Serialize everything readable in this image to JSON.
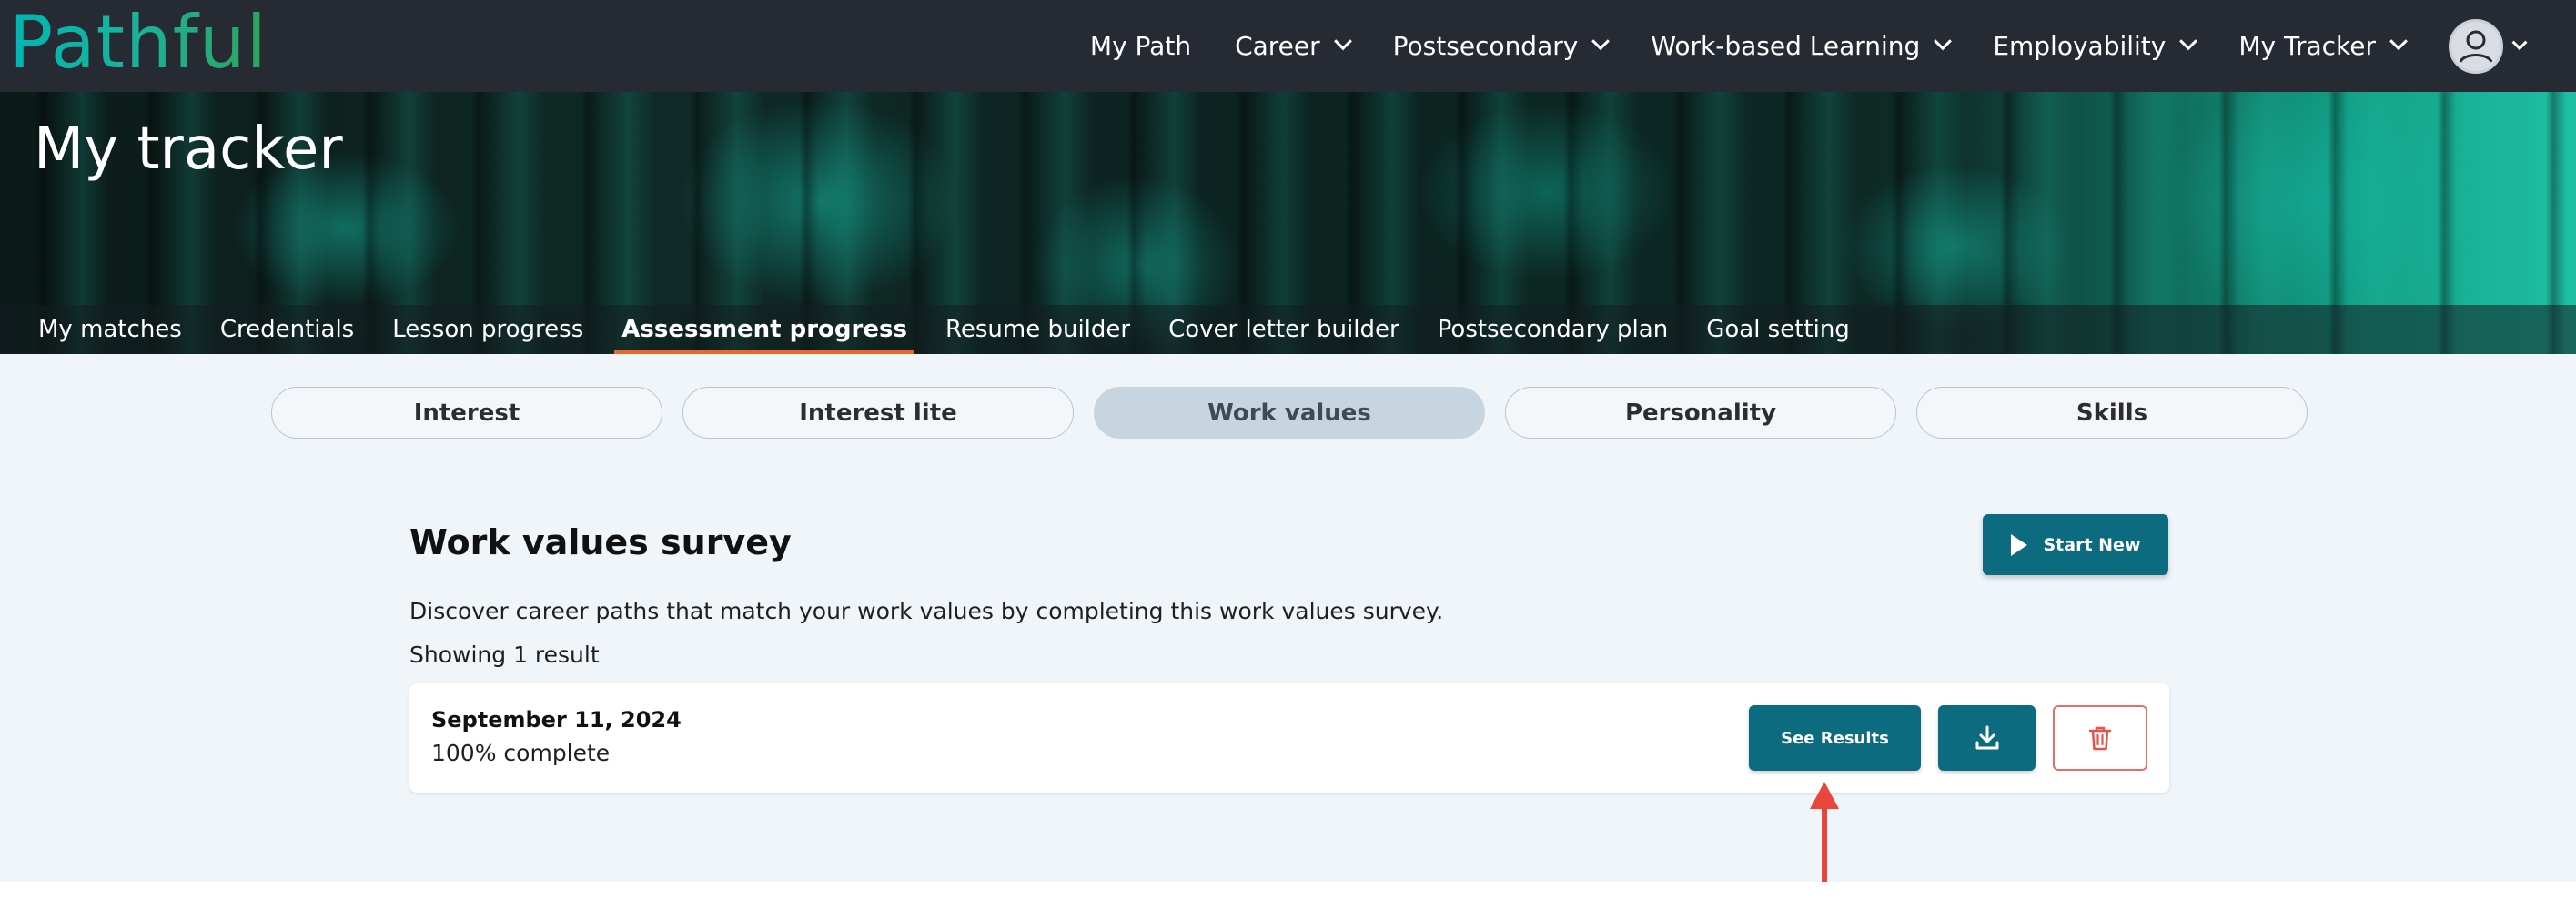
{
  "brand": {
    "logo_text": "Pathful"
  },
  "topnav": {
    "items": [
      {
        "label": "My Path",
        "has_dropdown": false
      },
      {
        "label": "Career",
        "has_dropdown": true
      },
      {
        "label": "Postsecondary",
        "has_dropdown": true
      },
      {
        "label": "Work-based Learning",
        "has_dropdown": true
      },
      {
        "label": "Employability",
        "has_dropdown": true
      },
      {
        "label": "My Tracker",
        "has_dropdown": true
      }
    ],
    "avatar_icon": "user-circle-icon"
  },
  "hero": {
    "title": "My tracker",
    "tabs": [
      {
        "label": "My matches",
        "active": false
      },
      {
        "label": "Credentials",
        "active": false
      },
      {
        "label": "Lesson progress",
        "active": false
      },
      {
        "label": "Assessment progress",
        "active": true
      },
      {
        "label": "Resume builder",
        "active": false
      },
      {
        "label": "Cover letter builder",
        "active": false
      },
      {
        "label": "Postsecondary plan",
        "active": false
      },
      {
        "label": "Goal setting",
        "active": false
      }
    ]
  },
  "assessment_tabs": [
    {
      "label": "Interest",
      "active": false
    },
    {
      "label": "Interest lite",
      "active": false
    },
    {
      "label": "Work values",
      "active": true
    },
    {
      "label": "Personality",
      "active": false
    },
    {
      "label": "Skills",
      "active": false
    }
  ],
  "survey": {
    "title": "Work values survey",
    "start_button": "Start New",
    "description": "Discover career paths that match your work values by completing this work values survey.",
    "result_count": "Showing 1 result"
  },
  "results": [
    {
      "date": "September 11, 2024",
      "status": "100% complete",
      "see_results_label": "See Results",
      "download_icon": "download-icon",
      "delete_icon": "trash-icon"
    }
  ],
  "colors": {
    "nav_bg": "#262b33",
    "primary_button": "#0d6b80",
    "active_tab_underline": "#e5692c",
    "delete_border": "#e57068",
    "content_bg": "#f0f5f9",
    "annotation_arrow": "#e8453c"
  }
}
